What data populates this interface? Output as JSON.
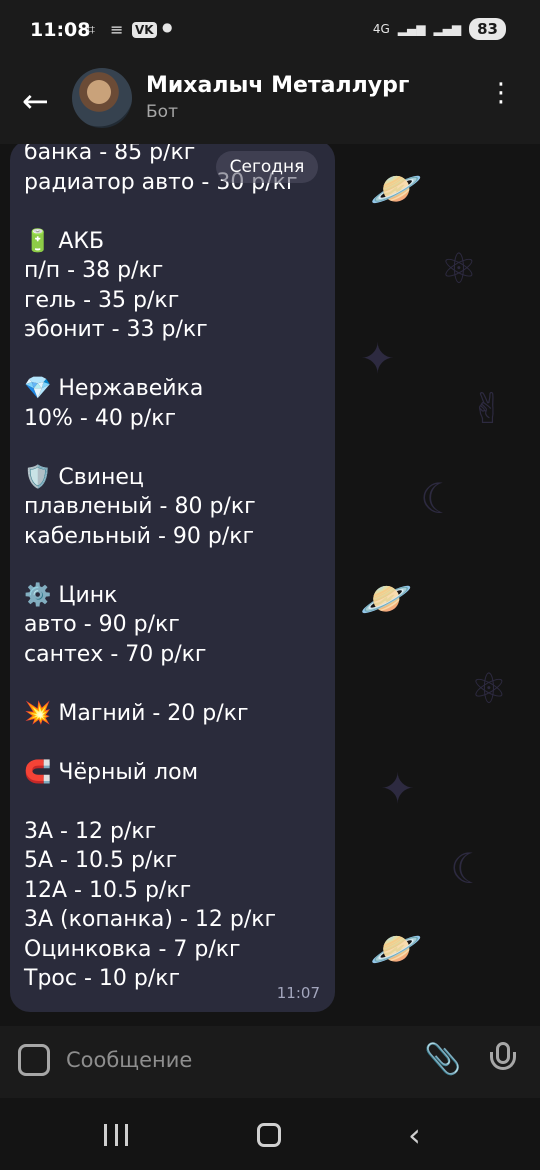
{
  "status_bar": {
    "time": "11:08",
    "vk_label": "VK",
    "network_label": "4G",
    "battery": "83"
  },
  "header": {
    "title": "Михалыч Металлург",
    "subtitle": "Бот"
  },
  "date_chip": "Сегодня",
  "message": {
    "text": "банка - 85 р/кг\nрадиатор авто - 30 р/кг\n\n🔋 АКБ\nп/п - 38 р/кг\nгель - 35 р/кг\nэбонит - 33 р/кг\n\n💎 Нержавейка\n10% - 40 р/кг\n\n🛡️ Свинец\nплавленый - 80 р/кг\nкабельный - 90 р/кг\n\n⚙️ Цинк\nавто - 90 р/кг\nсантех - 70 р/кг\n\n💥 Магний - 20 р/кг\n\n🧲 Чёрный лом\n\n3А - 12 р/кг\n5А - 10.5 р/кг\n12А - 10.5 р/кг\n3А (копанка) - 12 р/кг\nОцинковка - 7 р/кг\nТрос - 10 р/кг",
    "time": "11:07"
  },
  "input": {
    "placeholder": "Сообщение"
  },
  "icons": {
    "back": "arrow-left-icon",
    "menu": "more-vertical-icon",
    "emoji": "sticker-icon",
    "attach": "paperclip-icon",
    "mic": "microphone-icon"
  },
  "colors": {
    "bubble": "#2a2b3b",
    "background": "#141414",
    "header": "#1b1b1b"
  }
}
